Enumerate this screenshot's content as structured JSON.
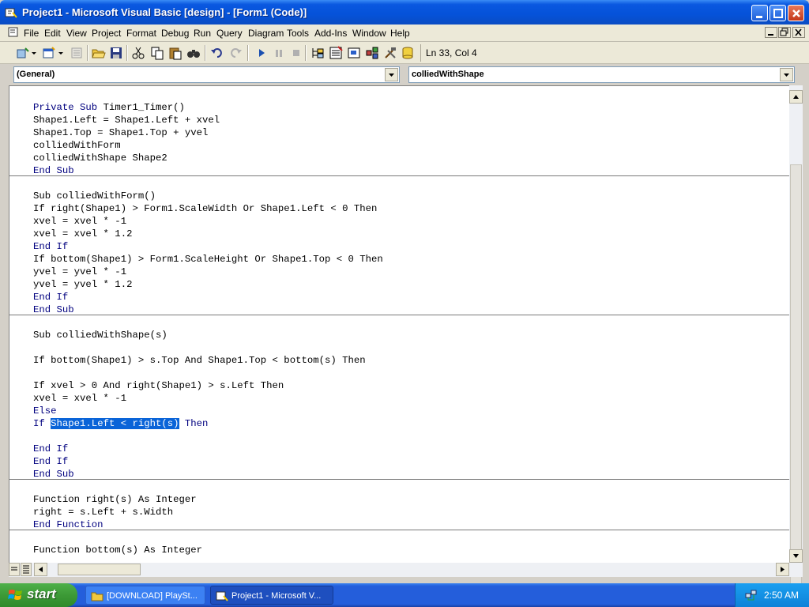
{
  "window": {
    "title": "Project1 - Microsoft Visual Basic [design] - [Form1 (Code)]"
  },
  "menu": {
    "items": [
      "File",
      "Edit",
      "View",
      "Project",
      "Format",
      "Debug",
      "Run",
      "Query",
      "Diagram",
      "Tools",
      "Add-Ins",
      "Window",
      "Help"
    ]
  },
  "toolbar": {
    "position": "Ln 33, Col 4"
  },
  "combos": {
    "object": "(General)",
    "procedure": "colliedWithShape"
  },
  "code": {
    "lines": [
      "Private Sub Timer1_Timer()",
      "Shape1.Left = Shape1.Left + xvel",
      "Shape1.Top = Shape1.Top + yvel",
      "colliedWithForm",
      "colliedWithShape Shape2",
      "End Sub",
      "",
      "Sub colliedWithForm()",
      "If right(Shape1) > Form1.ScaleWidth Or Shape1.Left < 0 Then",
      "xvel = xvel * -1",
      "xvel = xvel * 1.2",
      "End If",
      "If bottom(Shape1) > Form1.ScaleHeight Or Shape1.Top < 0 Then",
      "yvel = yvel * -1",
      "yvel = yvel * 1.2",
      "End If",
      "End Sub",
      "",
      "Sub colliedWithShape(s)",
      "",
      "If bottom(Shape1) > s.Top And Shape1.Top < bottom(s) Then",
      "",
      "If xvel > 0 And right(Shape1) > s.Left Then",
      "xvel = xvel * -1",
      "Else",
      "If Shape1.Left < right(s) Then",
      "",
      "End If",
      "End If",
      "End Sub",
      "",
      "Function right(s) As Integer",
      "right = s.Left + s.Width",
      "End Function",
      "",
      "Function bottom(s) As Integer"
    ],
    "selection": "Shape1.Left < right(s)"
  },
  "taskbar": {
    "start_label": "start",
    "tasks": [
      "[DOWNLOAD] PlaySt...",
      "Project1 - Microsoft V..."
    ],
    "clock": "2:50 AM"
  },
  "colors": {
    "keyword": "#00007f",
    "selection": "#0a64d8",
    "titlebar": "#0552d9"
  }
}
